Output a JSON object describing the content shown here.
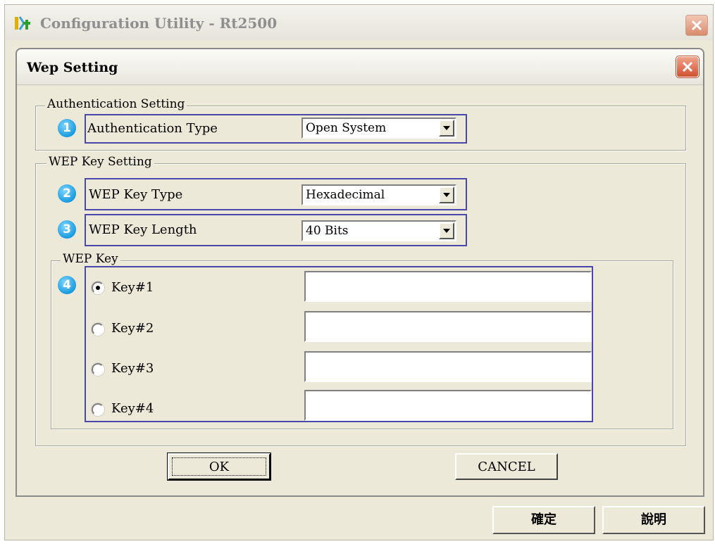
{
  "outer_window": {
    "title": "Configuration Utility - Rt2500",
    "confirm_button": "確定",
    "help_button": "說明"
  },
  "dialog": {
    "title": "Wep Setting",
    "authentication_group": {
      "label": "Authentication Setting",
      "badge": "1",
      "type_label": "Authentication Type",
      "type_value": "Open System"
    },
    "wep_key_group": {
      "label": "WEP Key Setting",
      "key_type": {
        "badge": "2",
        "label": "WEP Key Type",
        "value": "Hexadecimal"
      },
      "key_length": {
        "badge": "3",
        "label": "WEP Key Length",
        "value": "40 Bits"
      },
      "keys_group": {
        "label": "WEP Key",
        "badge": "4",
        "keys": [
          {
            "label": "Key#1",
            "selected": true,
            "value": ""
          },
          {
            "label": "Key#2",
            "selected": false,
            "value": ""
          },
          {
            "label": "Key#3",
            "selected": false,
            "value": ""
          },
          {
            "label": "Key#4",
            "selected": false,
            "value": ""
          }
        ]
      }
    },
    "ok_button": "OK",
    "cancel_button": "CANCEL"
  },
  "colors": {
    "highlight_border": "#4a48a8",
    "badge": "#1a9be0",
    "window_bg": "#ece9d8"
  }
}
